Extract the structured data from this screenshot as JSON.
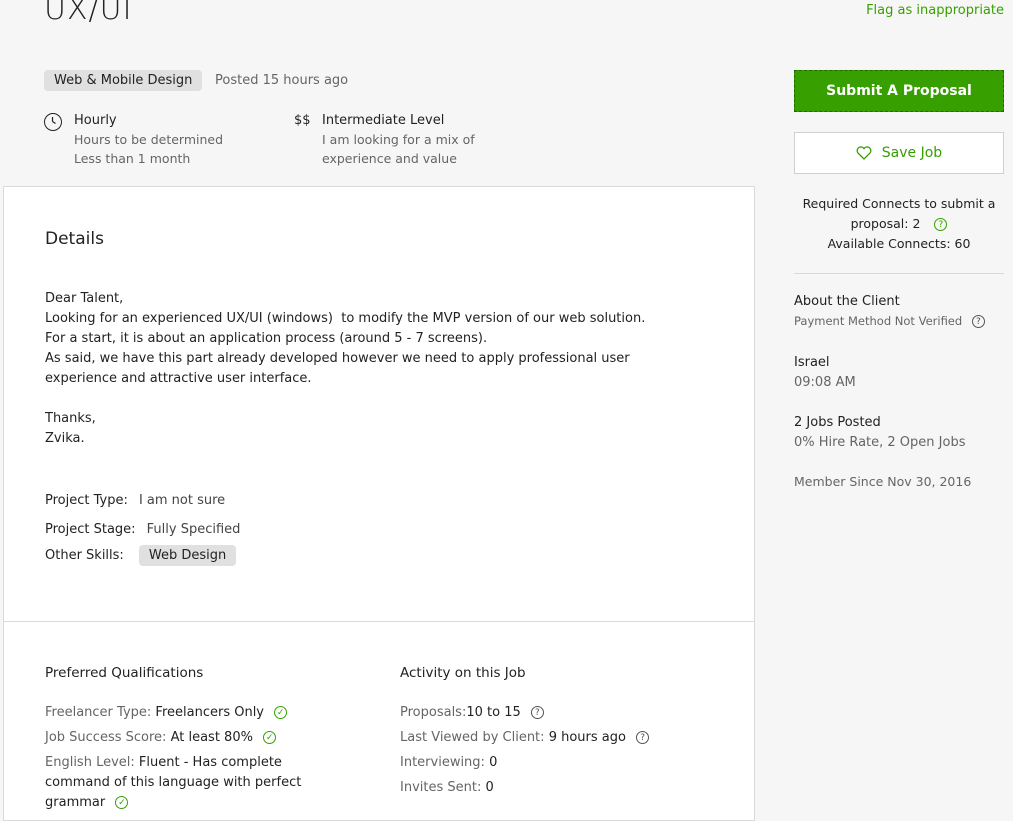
{
  "job": {
    "title": "UX/UI",
    "flag_link": "Flag as inappropriate",
    "category": "Web & Mobile Design",
    "posted": "Posted 15 hours ago"
  },
  "features": {
    "hourly": {
      "icon": "clock-icon",
      "title": "Hourly",
      "line1": "Hours to be determined",
      "line2": "Less than 1 month"
    },
    "level": {
      "icon_text": "$$",
      "title": "Intermediate Level",
      "line1": "I am looking for a mix of",
      "line2": "experience and value"
    }
  },
  "details": {
    "heading": "Details",
    "lines": [
      "Dear Talent,",
      "Looking for an experienced UX/UI (windows)  to modify the MVP version of our web solution.",
      "For a start, it is about an application process (around 5 - 7 screens).",
      "As said, we have this part already developed however we need to apply professional user",
      "experience and attractive user interface.",
      "",
      "Thanks,",
      "Zvika."
    ],
    "project_type_label": "Project Type:",
    "project_type_value": "I am not sure",
    "project_stage_label": "Project Stage:",
    "project_stage_value": "Fully Specified",
    "other_skills_label": "Other Skills:",
    "other_skills_chip": "Web Design"
  },
  "qualifications": {
    "heading": "Preferred Qualifications",
    "freelancer_type_label": "Freelancer Type:",
    "freelancer_type_value": "Freelancers Only",
    "job_success_label": "Job Success Score:",
    "job_success_value": "At least 80%",
    "english_label": "English Level:",
    "english_value_1": "Fluent - Has complete",
    "english_value_2": "command of this language with perfect",
    "english_value_3": "grammar"
  },
  "activity": {
    "heading": "Activity on this Job",
    "proposals_label": "Proposals:",
    "proposals_value": "10 to 15",
    "last_viewed_label": "Last Viewed by Client:",
    "last_viewed_value": "9 hours ago",
    "interviewing_label": "Interviewing:",
    "interviewing_value": "0",
    "invites_label": "Invites Sent:",
    "invites_value": "0"
  },
  "sidebar": {
    "submit_label": "Submit A Proposal",
    "save_label": "Save Job",
    "connects_line1": "Required Connects to submit a",
    "connects_line2": "proposal: 2",
    "connects_line3": "Available Connects: 60",
    "about_heading": "About the Client",
    "payment": "Payment Method Not Verified",
    "country": "Israel",
    "time": "09:08 AM",
    "jobs_posted": "2 Jobs Posted",
    "hire_rate": "0% Hire Rate, 2 Open Jobs",
    "member_since": "Member Since Nov 30, 2016"
  },
  "colors": {
    "accent": "#37a000",
    "panel_border": "#dadada",
    "muted_text": "#656565"
  }
}
